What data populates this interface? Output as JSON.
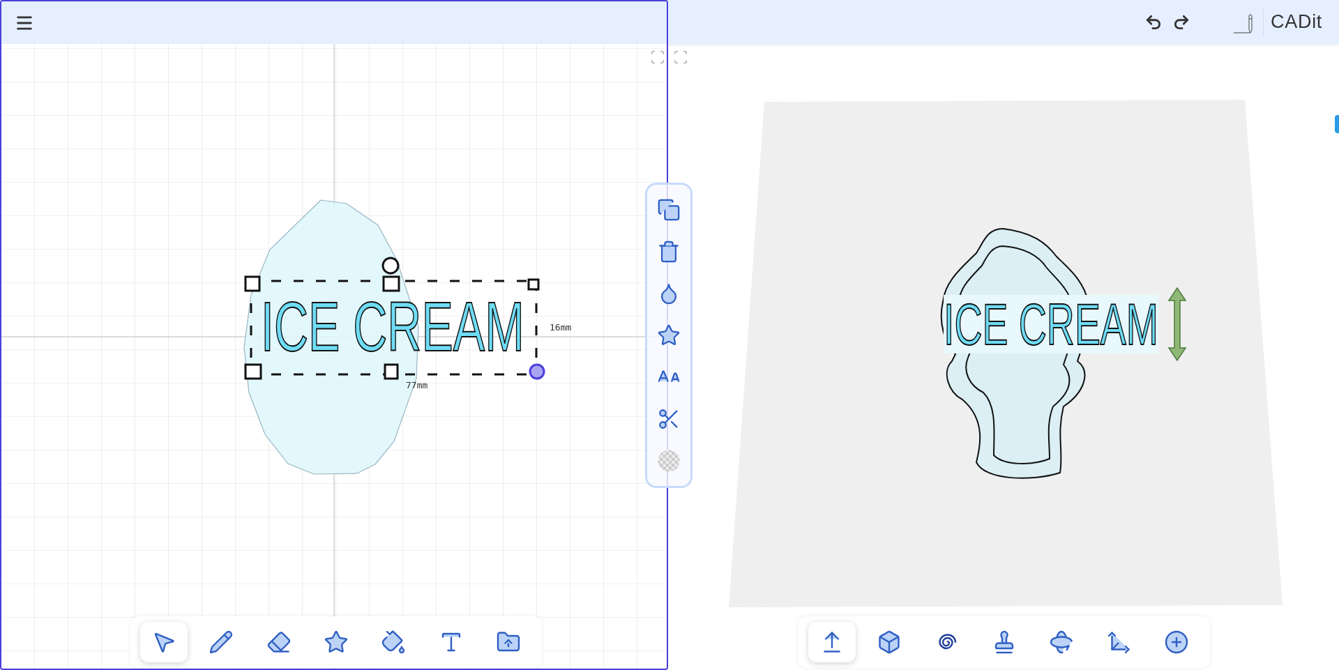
{
  "header": {
    "title": "CADit"
  },
  "canvas": {
    "text": "ICE CREAM",
    "width_label": "77mm",
    "height_label": "16mm"
  },
  "draw_tools": [
    {
      "kind": "select",
      "selected": true
    },
    {
      "kind": "pencil",
      "selected": false
    },
    {
      "kind": "eraser",
      "selected": false
    },
    {
      "kind": "star",
      "selected": false
    },
    {
      "kind": "fill",
      "selected": false
    },
    {
      "kind": "text",
      "selected": false
    },
    {
      "kind": "import",
      "selected": false
    }
  ],
  "shape_actions": [
    {
      "kind": "duplicate"
    },
    {
      "kind": "delete"
    },
    {
      "kind": "color"
    },
    {
      "kind": "star"
    },
    {
      "kind": "font"
    },
    {
      "kind": "cut"
    },
    {
      "kind": "transparency"
    }
  ],
  "view3d": {
    "text": "ICE CREAM"
  },
  "view_tools": [
    {
      "kind": "extrude",
      "selected": true
    },
    {
      "kind": "warp",
      "selected": false
    },
    {
      "kind": "spiral",
      "selected": false
    },
    {
      "kind": "stamp",
      "selected": false
    },
    {
      "kind": "rotate",
      "selected": false
    },
    {
      "kind": "scale",
      "selected": false
    },
    {
      "kind": "add",
      "selected": false
    }
  ]
}
